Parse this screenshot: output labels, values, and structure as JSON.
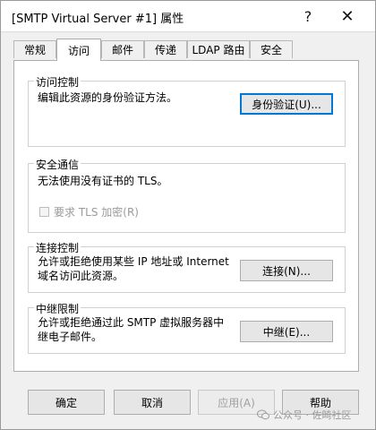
{
  "window": {
    "title": "[SMTP Virtual Server #1] 属性",
    "help_glyph": "?",
    "close_glyph": "✕"
  },
  "tabs": [
    {
      "label": "常规"
    },
    {
      "label": "访问"
    },
    {
      "label": "邮件"
    },
    {
      "label": "传递"
    },
    {
      "label": "LDAP 路由"
    },
    {
      "label": "安全"
    }
  ],
  "active_tab": "访问",
  "groups": {
    "access_control": {
      "title": "访问控制",
      "description": "编辑此资源的身份验证方法。",
      "button": "身份验证(U)..."
    },
    "secure_comm": {
      "title": "安全通信",
      "description": "无法使用没有证书的 TLS。",
      "checkbox_label": "要求 TLS 加密(R)",
      "checkbox_checked": false
    },
    "connection_control": {
      "title": "连接控制",
      "description_line1": "允许或拒绝使用某些 IP 地址或 Internet",
      "description_line2": "域名访问此资源。",
      "button": "连接(N)..."
    },
    "relay_restrictions": {
      "title": "中继限制",
      "description_line1": "允许或拒绝通过此 SMTP 虚拟服务器中",
      "description_line2": "继电子邮件。",
      "button": "中继(E)..."
    }
  },
  "footer": {
    "ok": "确定",
    "cancel": "取消",
    "apply": "应用(A)",
    "help": "帮助"
  },
  "watermark": "公众号 · 佐畸社区"
}
